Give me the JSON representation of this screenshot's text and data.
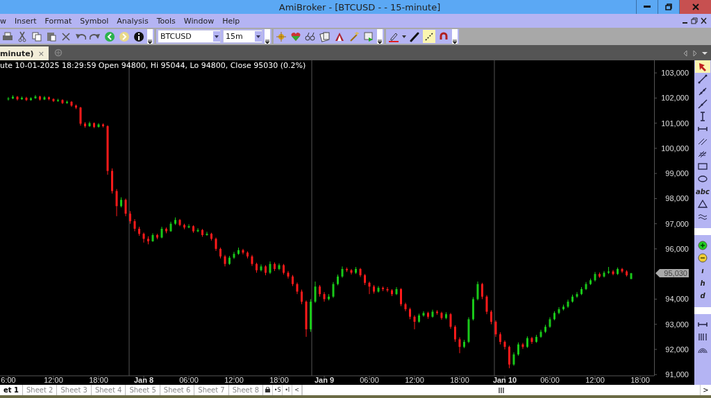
{
  "window": {
    "title": "AmiBroker - [BTCUSD -  - 15-minute]"
  },
  "menu": [
    "w",
    "Insert",
    "Format",
    "Symbol",
    "Analysis",
    "Tools",
    "Window",
    "Help"
  ],
  "toolbar": {
    "symbol": "BTCUSD",
    "interval": "15m",
    "drawing_tools": [
      {
        "kind": "pencil",
        "on": false
      },
      {
        "kind": "dotted-line",
        "on": true
      },
      {
        "kind": "magnet",
        "on": false
      }
    ]
  },
  "chart_tab": {
    "label": "minute)",
    "close": "×"
  },
  "chart": {
    "info": "ute 10-01-2025 18:29:59 Open 94800, Hi 95044, Lo 94800, Close 95030 (0.2%)",
    "last_price": "95,030",
    "chart_data": {
      "type": "candlestick",
      "categories": [
        "6:00",
        null,
        null,
        null,
        null,
        null,
        null,
        null,
        null,
        null,
        "12:00",
        null,
        null,
        null,
        null,
        null,
        null,
        null,
        null,
        null,
        "18:00",
        null,
        null,
        null,
        null,
        null,
        null,
        null,
        null,
        null,
        "Jan 8",
        null,
        null,
        null,
        null,
        null,
        null,
        null,
        null,
        null,
        "06:00",
        null,
        null,
        null,
        null,
        null,
        null,
        null,
        null,
        null,
        "12:00",
        null,
        null,
        null,
        null,
        null,
        null,
        null,
        null,
        null,
        "18:00",
        null,
        null,
        null,
        null,
        null,
        null,
        null,
        null,
        null,
        "Jan 9",
        null,
        null,
        null,
        null,
        null,
        null,
        null,
        null,
        null,
        "06:00",
        null,
        null,
        null,
        null,
        null,
        null,
        null,
        null,
        null,
        "12:00",
        null,
        null,
        null,
        null,
        null,
        null,
        null,
        null,
        null,
        "18:00",
        null,
        null,
        null,
        null,
        null,
        null,
        null,
        null,
        null,
        "Jan 10",
        null,
        null,
        null,
        null,
        null,
        null,
        null,
        null,
        null,
        "06:00",
        null,
        null,
        null,
        null,
        null,
        null,
        null,
        null,
        null,
        "12:00",
        null,
        null,
        null,
        null,
        null,
        null,
        null,
        null,
        null,
        "18:00"
      ],
      "ohlc": [
        [
          101950,
          102040,
          101900,
          101980
        ],
        [
          101980,
          102110,
          101960,
          102050
        ],
        [
          102050,
          102080,
          101900,
          101950
        ],
        [
          101950,
          102060,
          101930,
          102010
        ],
        [
          102010,
          102050,
          101880,
          101920
        ],
        [
          101920,
          102030,
          101890,
          101990
        ],
        [
          101990,
          102120,
          101970,
          102060
        ],
        [
          102060,
          102090,
          101900,
          101940
        ],
        [
          101940,
          102080,
          101920,
          102030
        ],
        [
          102030,
          102060,
          101910,
          101960
        ],
        [
          101960,
          101990,
          101840,
          101880
        ],
        [
          101880,
          101970,
          101850,
          101920
        ],
        [
          101920,
          101950,
          101760,
          101800
        ],
        [
          101800,
          101900,
          101770,
          101850
        ],
        [
          101850,
          101880,
          101650,
          101700
        ],
        [
          101700,
          101740,
          101560,
          101620
        ],
        [
          101620,
          101650,
          100900,
          100980
        ],
        [
          100980,
          101040,
          100820,
          100880
        ],
        [
          100880,
          101060,
          100850,
          101000
        ],
        [
          101000,
          101030,
          100800,
          100850
        ],
        [
          100850,
          101000,
          100820,
          100950
        ],
        [
          100950,
          100990,
          100830,
          100880
        ],
        [
          100880,
          100920,
          98950,
          99100
        ],
        [
          99100,
          99200,
          98200,
          98300
        ],
        [
          98300,
          98380,
          97300,
          97700
        ],
        [
          97700,
          98050,
          97650,
          97950
        ],
        [
          97950,
          98000,
          97300,
          97400
        ],
        [
          97400,
          97500,
          97000,
          97100
        ],
        [
          97100,
          97180,
          96700,
          96800
        ],
        [
          96800,
          96880,
          96520,
          96600
        ],
        [
          96600,
          96650,
          96250,
          96400
        ],
        [
          96400,
          96500,
          96180,
          96300
        ],
        [
          96300,
          96620,
          96280,
          96550
        ],
        [
          96550,
          96600,
          96380,
          96450
        ],
        [
          96450,
          96880,
          96420,
          96800
        ],
        [
          96800,
          96850,
          96620,
          96700
        ],
        [
          96700,
          97080,
          96680,
          97000
        ],
        [
          97000,
          97250,
          96950,
          97150
        ],
        [
          97150,
          97190,
          96900,
          96950
        ],
        [
          96950,
          97000,
          96780,
          96850
        ],
        [
          96850,
          96980,
          96820,
          96900
        ],
        [
          96900,
          96940,
          96640,
          96700
        ],
        [
          96700,
          96820,
          96660,
          96750
        ],
        [
          96750,
          96790,
          96480,
          96550
        ],
        [
          96550,
          96680,
          96520,
          96600
        ],
        [
          96600,
          96640,
          96330,
          96400
        ],
        [
          96400,
          96450,
          95920,
          96000
        ],
        [
          96000,
          96050,
          95620,
          95700
        ],
        [
          95700,
          95760,
          95300,
          95400
        ],
        [
          95400,
          95720,
          95360,
          95650
        ],
        [
          95650,
          95880,
          95600,
          95800
        ],
        [
          95800,
          96050,
          95760,
          95950
        ],
        [
          95950,
          96000,
          95780,
          95850
        ],
        [
          95850,
          95900,
          95620,
          95700
        ],
        [
          95700,
          95760,
          95320,
          95400
        ],
        [
          95400,
          95450,
          95050,
          95150
        ],
        [
          95150,
          95380,
          95100,
          95300
        ],
        [
          95300,
          95350,
          94950,
          95050
        ],
        [
          95050,
          95500,
          95000,
          95400
        ],
        [
          95400,
          95460,
          95120,
          95200
        ],
        [
          95200,
          95420,
          95150,
          95350
        ],
        [
          95350,
          95400,
          94980,
          95050
        ],
        [
          95050,
          95120,
          94820,
          94900
        ],
        [
          94900,
          94960,
          94520,
          94600
        ],
        [
          94600,
          94660,
          94200,
          94300
        ],
        [
          94300,
          94380,
          93800,
          93900
        ],
        [
          93900,
          93950,
          92500,
          92800
        ],
        [
          92800,
          94000,
          92700,
          93900
        ],
        [
          93900,
          94700,
          93850,
          94500
        ],
        [
          94500,
          94560,
          94100,
          94200
        ],
        [
          94200,
          94280,
          93900,
          94000
        ],
        [
          94000,
          94200,
          93950,
          94100
        ],
        [
          94100,
          94680,
          94050,
          94600
        ],
        [
          94600,
          94980,
          94550,
          94900
        ],
        [
          94900,
          95300,
          94850,
          95200
        ],
        [
          95200,
          95260,
          95080,
          95150
        ],
        [
          95150,
          95200,
          94980,
          95050
        ],
        [
          95050,
          95280,
          95000,
          95200
        ],
        [
          95200,
          95240,
          94880,
          94950
        ],
        [
          94950,
          95000,
          94560,
          94650
        ],
        [
          94650,
          94700,
          94200,
          94500
        ],
        [
          94500,
          94560,
          94220,
          94300
        ],
        [
          94300,
          94520,
          94260,
          94450
        ],
        [
          94450,
          94500,
          94320,
          94400
        ],
        [
          94400,
          94480,
          94280,
          94350
        ],
        [
          94350,
          94400,
          94120,
          94200
        ],
        [
          94200,
          94480,
          94160,
          94400
        ],
        [
          94400,
          94440,
          93720,
          93800
        ],
        [
          93800,
          93860,
          93520,
          93600
        ],
        [
          93600,
          93660,
          93200,
          93300
        ],
        [
          93300,
          93360,
          92800,
          93100
        ],
        [
          93100,
          93420,
          93060,
          93350
        ],
        [
          93350,
          93520,
          93300,
          93450
        ],
        [
          93450,
          93500,
          93220,
          93300
        ],
        [
          93300,
          93580,
          93260,
          93500
        ],
        [
          93500,
          93560,
          93380,
          93450
        ],
        [
          93450,
          93500,
          93180,
          93250
        ],
        [
          93250,
          93480,
          93200,
          93400
        ],
        [
          93400,
          93450,
          92820,
          92900
        ],
        [
          92900,
          92960,
          92300,
          92400
        ],
        [
          92400,
          92480,
          91850,
          92100
        ],
        [
          92100,
          92380,
          92050,
          92300
        ],
        [
          92300,
          93280,
          92250,
          93200
        ],
        [
          93200,
          94080,
          93150,
          94000
        ],
        [
          94000,
          94700,
          93950,
          94600
        ],
        [
          94600,
          94650,
          94000,
          94100
        ],
        [
          94100,
          94160,
          93400,
          93500
        ],
        [
          93500,
          93560,
          93000,
          93100
        ],
        [
          93100,
          93160,
          92500,
          92600
        ],
        [
          92600,
          92680,
          92200,
          92300
        ],
        [
          92300,
          92360,
          92000,
          92100
        ],
        [
          92100,
          92150,
          91250,
          91400
        ],
        [
          91400,
          91880,
          91350,
          91800
        ],
        [
          91800,
          92280,
          91750,
          92200
        ],
        [
          92200,
          92260,
          92020,
          92100
        ],
        [
          92100,
          92520,
          92060,
          92450
        ],
        [
          92450,
          92500,
          92220,
          92300
        ],
        [
          92300,
          92580,
          92260,
          92500
        ],
        [
          92500,
          92780,
          92460,
          92700
        ],
        [
          92700,
          92980,
          92650,
          92900
        ],
        [
          92900,
          93280,
          92860,
          93200
        ],
        [
          93200,
          93520,
          93160,
          93450
        ],
        [
          93450,
          93680,
          93400,
          93600
        ],
        [
          93600,
          93780,
          93550,
          93700
        ],
        [
          93700,
          93980,
          93650,
          93900
        ],
        [
          93900,
          94180,
          93860,
          94100
        ],
        [
          94100,
          94280,
          94050,
          94200
        ],
        [
          94200,
          94480,
          94160,
          94400
        ],
        [
          94400,
          94680,
          94360,
          94600
        ],
        [
          94600,
          94820,
          94560,
          94750
        ],
        [
          94750,
          95080,
          94700,
          95000
        ],
        [
          95000,
          95060,
          94850,
          94900
        ],
        [
          94900,
          95120,
          94860,
          95050
        ],
        [
          95050,
          95280,
          95000,
          95100
        ],
        [
          95100,
          95160,
          94950,
          95000
        ],
        [
          95000,
          95260,
          94960,
          95200
        ],
        [
          95200,
          95240,
          95040,
          95100
        ],
        [
          95100,
          95150,
          94900,
          94950
        ],
        [
          94800,
          95044,
          94800,
          95030
        ],
        null,
        null
      ],
      "ylim": [
        90950,
        103500
      ],
      "yticks": [
        {
          "value": 103000,
          "label": "103,000"
        },
        {
          "value": 102000,
          "label": "102,000"
        },
        {
          "value": 101000,
          "label": "101,000"
        },
        {
          "value": 100000,
          "label": "100,000"
        },
        {
          "value": 99000,
          "label": "99,000"
        },
        {
          "value": 98000,
          "label": "98,000"
        },
        {
          "value": 97000,
          "label": "97,000"
        },
        {
          "value": 96000,
          "label": "96,000"
        },
        {
          "value": 94000,
          "label": "94,000"
        },
        {
          "value": 93000,
          "label": "93,000"
        },
        {
          "value": 92000,
          "label": "92,000"
        },
        {
          "value": 91000,
          "label": "91,000"
        }
      ]
    },
    "time_label_styles": [
      {
        "bold": false
      },
      {
        "bold": false
      },
      {
        "bold": false
      },
      {
        "bold": true
      },
      {
        "bold": false
      },
      {
        "bold": false
      },
      {
        "bold": false
      },
      {
        "bold": true
      },
      {
        "bold": false
      },
      {
        "bold": false
      },
      {
        "bold": false
      },
      {
        "bold": true
      },
      {
        "bold": false
      },
      {
        "bold": false
      },
      {
        "bold": false
      }
    ]
  },
  "palette": [
    {
      "kind": "cursor",
      "selected": true
    },
    {
      "kind": "line",
      "selected": false
    },
    {
      "kind": "ray",
      "selected": false
    },
    {
      "kind": "extended",
      "selected": false
    },
    {
      "kind": "vline",
      "selected": false
    },
    {
      "kind": "hline",
      "selected": false
    },
    {
      "kind": "parallel",
      "selected": false
    },
    {
      "kind": "hatch",
      "selected": false
    },
    {
      "kind": "rect",
      "selected": false
    },
    {
      "kind": "ellipse",
      "selected": false
    },
    {
      "kind": "text",
      "label": "abc",
      "selected": false
    },
    {
      "kind": "triangle",
      "selected": false
    },
    {
      "kind": "wave",
      "selected": false
    },
    {
      "kind": "grip"
    },
    {
      "kind": "zoom-in",
      "selected": false
    },
    {
      "kind": "zoom-out",
      "selected": false
    },
    {
      "kind": "text",
      "label": "ı",
      "selected": false
    },
    {
      "kind": "text",
      "label": "h",
      "selected": false
    },
    {
      "kind": "text",
      "label": "d",
      "selected": false
    },
    {
      "kind": "grip"
    },
    {
      "kind": "hline",
      "selected": false
    },
    {
      "kind": "bars",
      "selected": false
    },
    {
      "kind": "fan",
      "selected": false
    }
  ],
  "sheets": [
    {
      "label": "et 1",
      "selected": true
    },
    {
      "label": "Sheet 2",
      "selected": false
    },
    {
      "label": "Sheet 3",
      "selected": false
    },
    {
      "label": "Sheet 4",
      "selected": false
    },
    {
      "label": "Sheet 5",
      "selected": false
    },
    {
      "label": "Sheet 6",
      "selected": false
    },
    {
      "label": "Sheet 7",
      "selected": false
    },
    {
      "label": "Sheet 8",
      "selected": false
    }
  ],
  "sheet_buttons": [
    "•S",
    "•I",
    "<"
  ],
  "scroll_button": ">"
}
